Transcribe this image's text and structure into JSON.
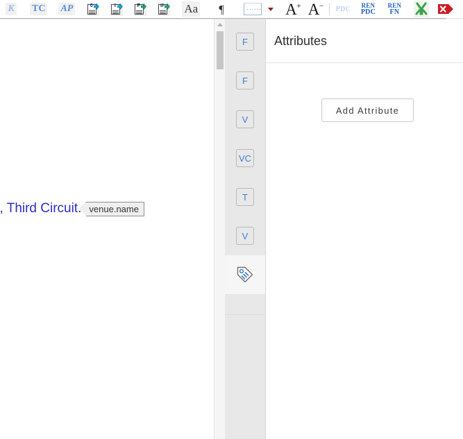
{
  "toolbar": {
    "items": [
      {
        "name": "k-marker-button",
        "kind": "glyph",
        "label": "K",
        "faint": true,
        "italic": true
      },
      {
        "name": "tc-toc-entry-button",
        "kind": "glyph",
        "label": "TC",
        "faint": false,
        "italic": false
      },
      {
        "name": "ap-authority-button",
        "kind": "glyph",
        "label": "AP",
        "faint": false,
        "italic": true
      },
      {
        "name": "insert-0-paragraph-button",
        "kind": "docicon",
        "label": "0"
      },
      {
        "name": "insert-i-paragraph-button",
        "kind": "docicon",
        "label": "I"
      },
      {
        "name": "insert-p-paragraph-button",
        "kind": "docicon",
        "label": "P"
      },
      {
        "name": "insert-ip-paragraph-button",
        "kind": "docicon",
        "label": "IP"
      },
      {
        "name": "change-case-button",
        "kind": "aa",
        "label": "Aa"
      },
      {
        "name": "show-formatting-marks-button",
        "kind": "pilcrow",
        "label": "¶"
      },
      {
        "name": "insert-field-button",
        "kind": "field",
        "label": ""
      },
      {
        "name": "field-options-dropdown",
        "kind": "caret",
        "label": ""
      },
      {
        "name": "increase-font-size-button",
        "kind": "bigA",
        "label": "A",
        "script": "+"
      },
      {
        "name": "decrease-font-size-button",
        "kind": "bigA",
        "label": "A",
        "script": "−"
      },
      {
        "name": "separator-1",
        "kind": "sep",
        "label": ""
      },
      {
        "name": "pdc-button",
        "kind": "pdc",
        "label": "PDC"
      },
      {
        "name": "ren-pdc-button",
        "kind": "ren",
        "label_top": "REN",
        "label_bottom": "PDC"
      },
      {
        "name": "ren-fn-button",
        "kind": "ren",
        "label_top": "REN",
        "label_bottom": "FN"
      },
      {
        "name": "merge-fields-button",
        "kind": "merge",
        "label": ""
      },
      {
        "name": "delete-tag-button",
        "kind": "delete",
        "label": ""
      },
      {
        "name": "table-tools-button",
        "kind": "table",
        "label": ""
      },
      {
        "name": "toolbar-overflow-button",
        "kind": "chevron",
        "label": "›"
      }
    ]
  },
  "document": {
    "visible_text": "s, Third Circuit",
    "period": ".",
    "tag_chip_label": "venue.name"
  },
  "scrollbar": {
    "name": "document-vertical-scrollbar"
  },
  "tab_rail": {
    "tabs": [
      {
        "name": "tab-field-1",
        "label": "F",
        "active": false,
        "icon": "letter"
      },
      {
        "name": "tab-field-2",
        "label": "F",
        "active": false,
        "icon": "letter"
      },
      {
        "name": "tab-variable-1",
        "label": "V",
        "active": false,
        "icon": "letter"
      },
      {
        "name": "tab-variable-content",
        "label": "VC",
        "active": false,
        "icon": "letter"
      },
      {
        "name": "tab-text",
        "label": "T",
        "active": false,
        "icon": "letter"
      },
      {
        "name": "tab-variable-2",
        "label": "V",
        "active": false,
        "icon": "letter"
      },
      {
        "name": "tab-attributes",
        "label": "",
        "active": true,
        "icon": "tag-icon"
      }
    ]
  },
  "attributes_panel": {
    "title": "Attributes",
    "add_button_label": "Add Attribute"
  },
  "colors": {
    "accent_blue": "#3c7fd0",
    "document_text_blue": "#2b2bc8",
    "rail_background": "#e8e8e8",
    "panel_background": "#ffffff",
    "border_gray": "#c9c9c9"
  }
}
